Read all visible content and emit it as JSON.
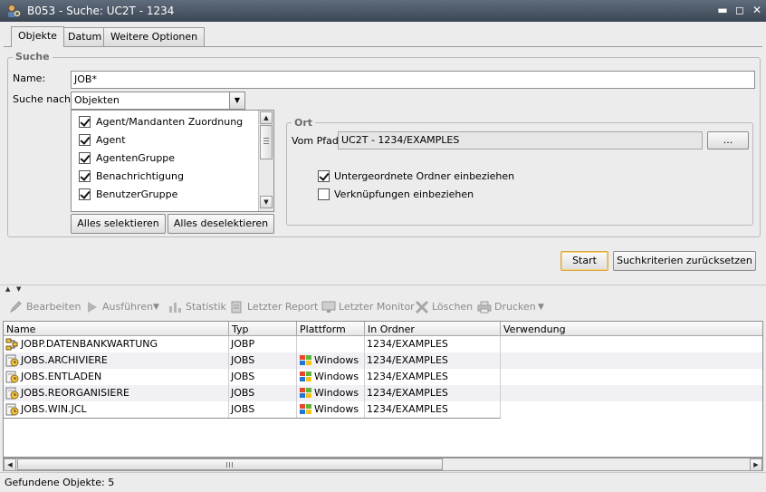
{
  "window": {
    "title": "B053 - Suche: UC2T - 1234",
    "icon": "search-person-icon",
    "controls": {
      "minimize": "▬",
      "maximize": "◻",
      "close": "✕"
    }
  },
  "tabs": [
    {
      "label": "Objekte",
      "active": true
    },
    {
      "label": "Datum",
      "active": false
    },
    {
      "label": "Weitere Optionen",
      "active": false
    }
  ],
  "search": {
    "legend": "Suche",
    "name_label": "Name:",
    "name_value": "JOB*",
    "search_for_label": "Suche nach:",
    "search_for_value": "Objekten",
    "object_types": [
      {
        "label": "Agent/Mandanten Zuordnung",
        "checked": true
      },
      {
        "label": "Agent",
        "checked": true
      },
      {
        "label": "AgentenGruppe",
        "checked": true
      },
      {
        "label": "Benachrichtigung",
        "checked": true
      },
      {
        "label": "BenutzerGruppe",
        "checked": true
      }
    ],
    "select_all": "Alles selektieren",
    "deselect_all": "Alles deselektieren"
  },
  "location": {
    "legend": "Ort",
    "path_label": "Vom Pfad:",
    "path_value": "UC2T - 1234/EXAMPLES",
    "browse": "...",
    "include_subfolders": "Untergeordnete Ordner einbeziehen",
    "include_subfolders_checked": true,
    "include_links": "Verknüpfungen einbeziehen",
    "include_links_checked": false
  },
  "actions": {
    "start": "Start",
    "reset": "Suchkriterien zurücksetzen"
  },
  "toolbar": {
    "edit": "Bearbeiten",
    "execute": "Ausführen",
    "statistics": "Statistik",
    "last_report": "Letzter Report",
    "last_monitor": "Letzter Monitor",
    "delete": "Löschen",
    "print": "Drucken"
  },
  "results": {
    "columns": [
      "Name",
      "Typ",
      "Plattform",
      "In Ordner",
      "Verwendung"
    ],
    "rows": [
      {
        "name": "JOBP.DATENBANKWARTUNG",
        "type": "JOBP",
        "platform": "",
        "folder": "1234/EXAMPLES",
        "usage": "",
        "icon": "workflow-icon"
      },
      {
        "name": "JOBS.ARCHIVIERE",
        "type": "JOBS",
        "platform": "Windows",
        "folder": "1234/EXAMPLES",
        "usage": "",
        "icon": "job-icon"
      },
      {
        "name": "JOBS.ENTLADEN",
        "type": "JOBS",
        "platform": "Windows",
        "folder": "1234/EXAMPLES",
        "usage": "",
        "icon": "job-icon"
      },
      {
        "name": "JOBS.REORGANISIERE",
        "type": "JOBS",
        "platform": "Windows",
        "folder": "1234/EXAMPLES",
        "usage": "",
        "icon": "job-icon"
      },
      {
        "name": "JOBS.WIN.JCL",
        "type": "JOBS",
        "platform": "Windows",
        "folder": "1234/EXAMPLES",
        "usage": "",
        "icon": "job-icon"
      }
    ]
  },
  "status": {
    "found": "Gefundene Objekte: 5"
  },
  "colors": {
    "titlebar": "#4a5564",
    "primary_button_border": "#d9a640",
    "row_alt": "#f0f0f5"
  }
}
